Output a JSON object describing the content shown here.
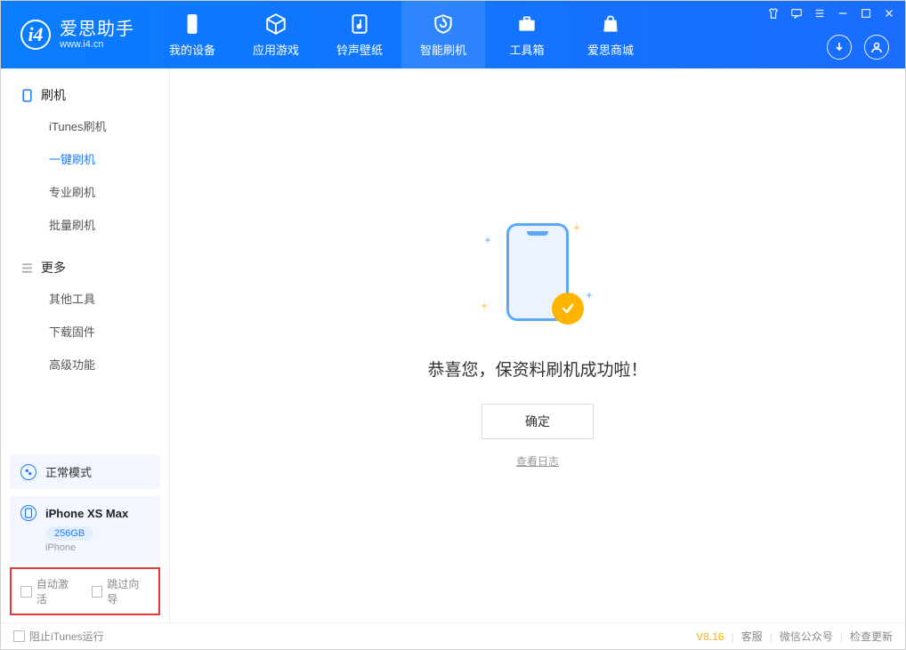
{
  "app": {
    "title": "爱思助手",
    "subtitle": "www.i4.cn"
  },
  "nav": {
    "device": "我的设备",
    "apps": "应用游戏",
    "ringtone": "铃声壁纸",
    "flash": "智能刷机",
    "toolbox": "工具箱",
    "store": "爱思商城"
  },
  "sidebar": {
    "group_flash": "刷机",
    "items_flash": {
      "itunes": "iTunes刷机",
      "oneclick": "一键刷机",
      "pro": "专业刷机",
      "batch": "批量刷机"
    },
    "group_more": "更多",
    "items_more": {
      "other": "其他工具",
      "firmware": "下载固件",
      "advanced": "高级功能"
    }
  },
  "mode": {
    "label": "正常模式"
  },
  "device": {
    "name": "iPhone XS Max",
    "capacity": "256GB",
    "type": "iPhone"
  },
  "checks": {
    "auto_activate": "自动激活",
    "skip_guide": "跳过向导"
  },
  "main": {
    "success": "恭喜您，保资料刷机成功啦！",
    "ok": "确定",
    "viewlog": "查看日志"
  },
  "footer": {
    "block_itunes": "阻止iTunes运行",
    "version": "V8.16",
    "support": "客服",
    "wechat": "微信公众号",
    "update": "检查更新"
  }
}
